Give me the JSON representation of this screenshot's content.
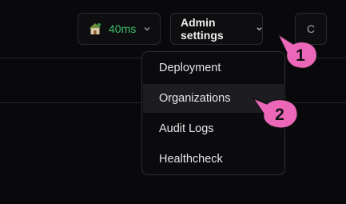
{
  "header": {
    "latency": {
      "icon": "house-icon",
      "label": "40ms",
      "color": "#3fbf6a"
    },
    "admin_settings": {
      "label": "Admin settings"
    },
    "user_button": {
      "label": "C"
    }
  },
  "admin_menu": {
    "items": [
      {
        "label": "Deployment"
      },
      {
        "label": "Organizations",
        "highlighted": true
      },
      {
        "label": "Audit Logs"
      },
      {
        "label": "Healthcheck"
      }
    ]
  },
  "annotations": [
    {
      "label": "1",
      "color": "#ec67b8"
    },
    {
      "label": "2",
      "color": "#ec67b8"
    }
  ]
}
